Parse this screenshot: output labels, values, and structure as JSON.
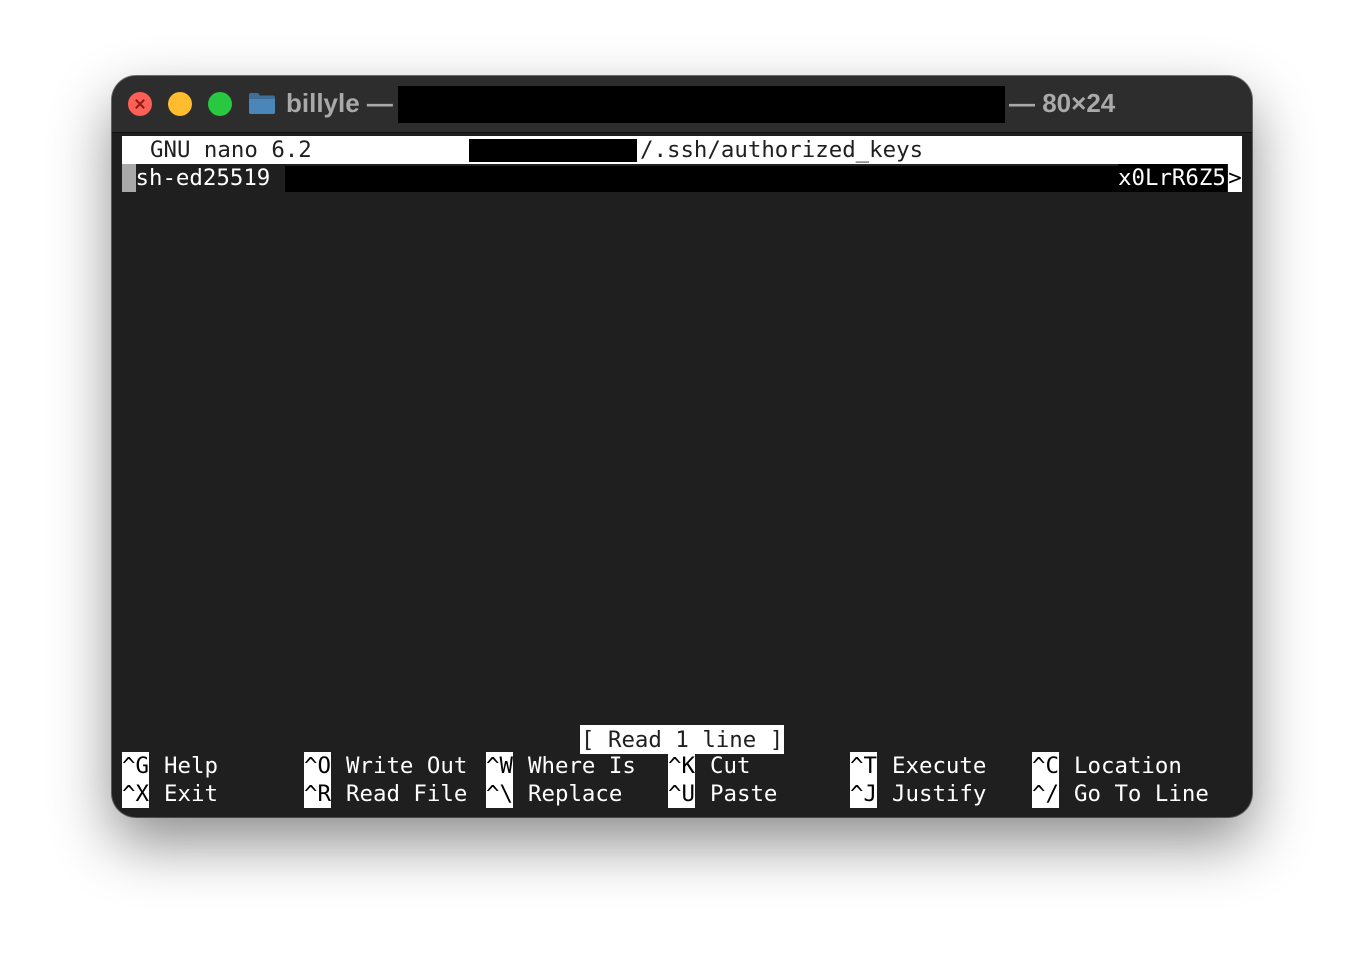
{
  "window": {
    "title_prefix": "billyle —",
    "title_suffix": "— 80×24",
    "icon": "folder-icon"
  },
  "nano": {
    "version": "GNU nano 6.2",
    "file_path": "/.ssh/authorized_keys",
    "line1_prefix": "ssh-ed25519",
    "line1_tail": "x0LrR6Z5",
    "line1_more": ">",
    "status": "[ Read 1 line ]"
  },
  "shortcuts": {
    "row1": [
      {
        "key": "^G",
        "label": "Help"
      },
      {
        "key": "^O",
        "label": "Write Out"
      },
      {
        "key": "^W",
        "label": "Where Is"
      },
      {
        "key": "^K",
        "label": "Cut"
      },
      {
        "key": "^T",
        "label": "Execute"
      },
      {
        "key": "^C",
        "label": "Location"
      }
    ],
    "row2": [
      {
        "key": "^X",
        "label": "Exit"
      },
      {
        "key": "^R",
        "label": "Read File"
      },
      {
        "key": "^\\",
        "label": "Replace"
      },
      {
        "key": "^U",
        "label": "Paste"
      },
      {
        "key": "^J",
        "label": "Justify"
      },
      {
        "key": "^/",
        "label": "Go To Line"
      }
    ]
  },
  "colors": {
    "terminal_bg": "#1f1f1f",
    "titlebar_bg": "#2d2d2d",
    "title_text": "#a9a9a9",
    "close": "#fe5f57",
    "minimize": "#febc2e",
    "zoom": "#28c840",
    "folder": "#4b86b8"
  }
}
